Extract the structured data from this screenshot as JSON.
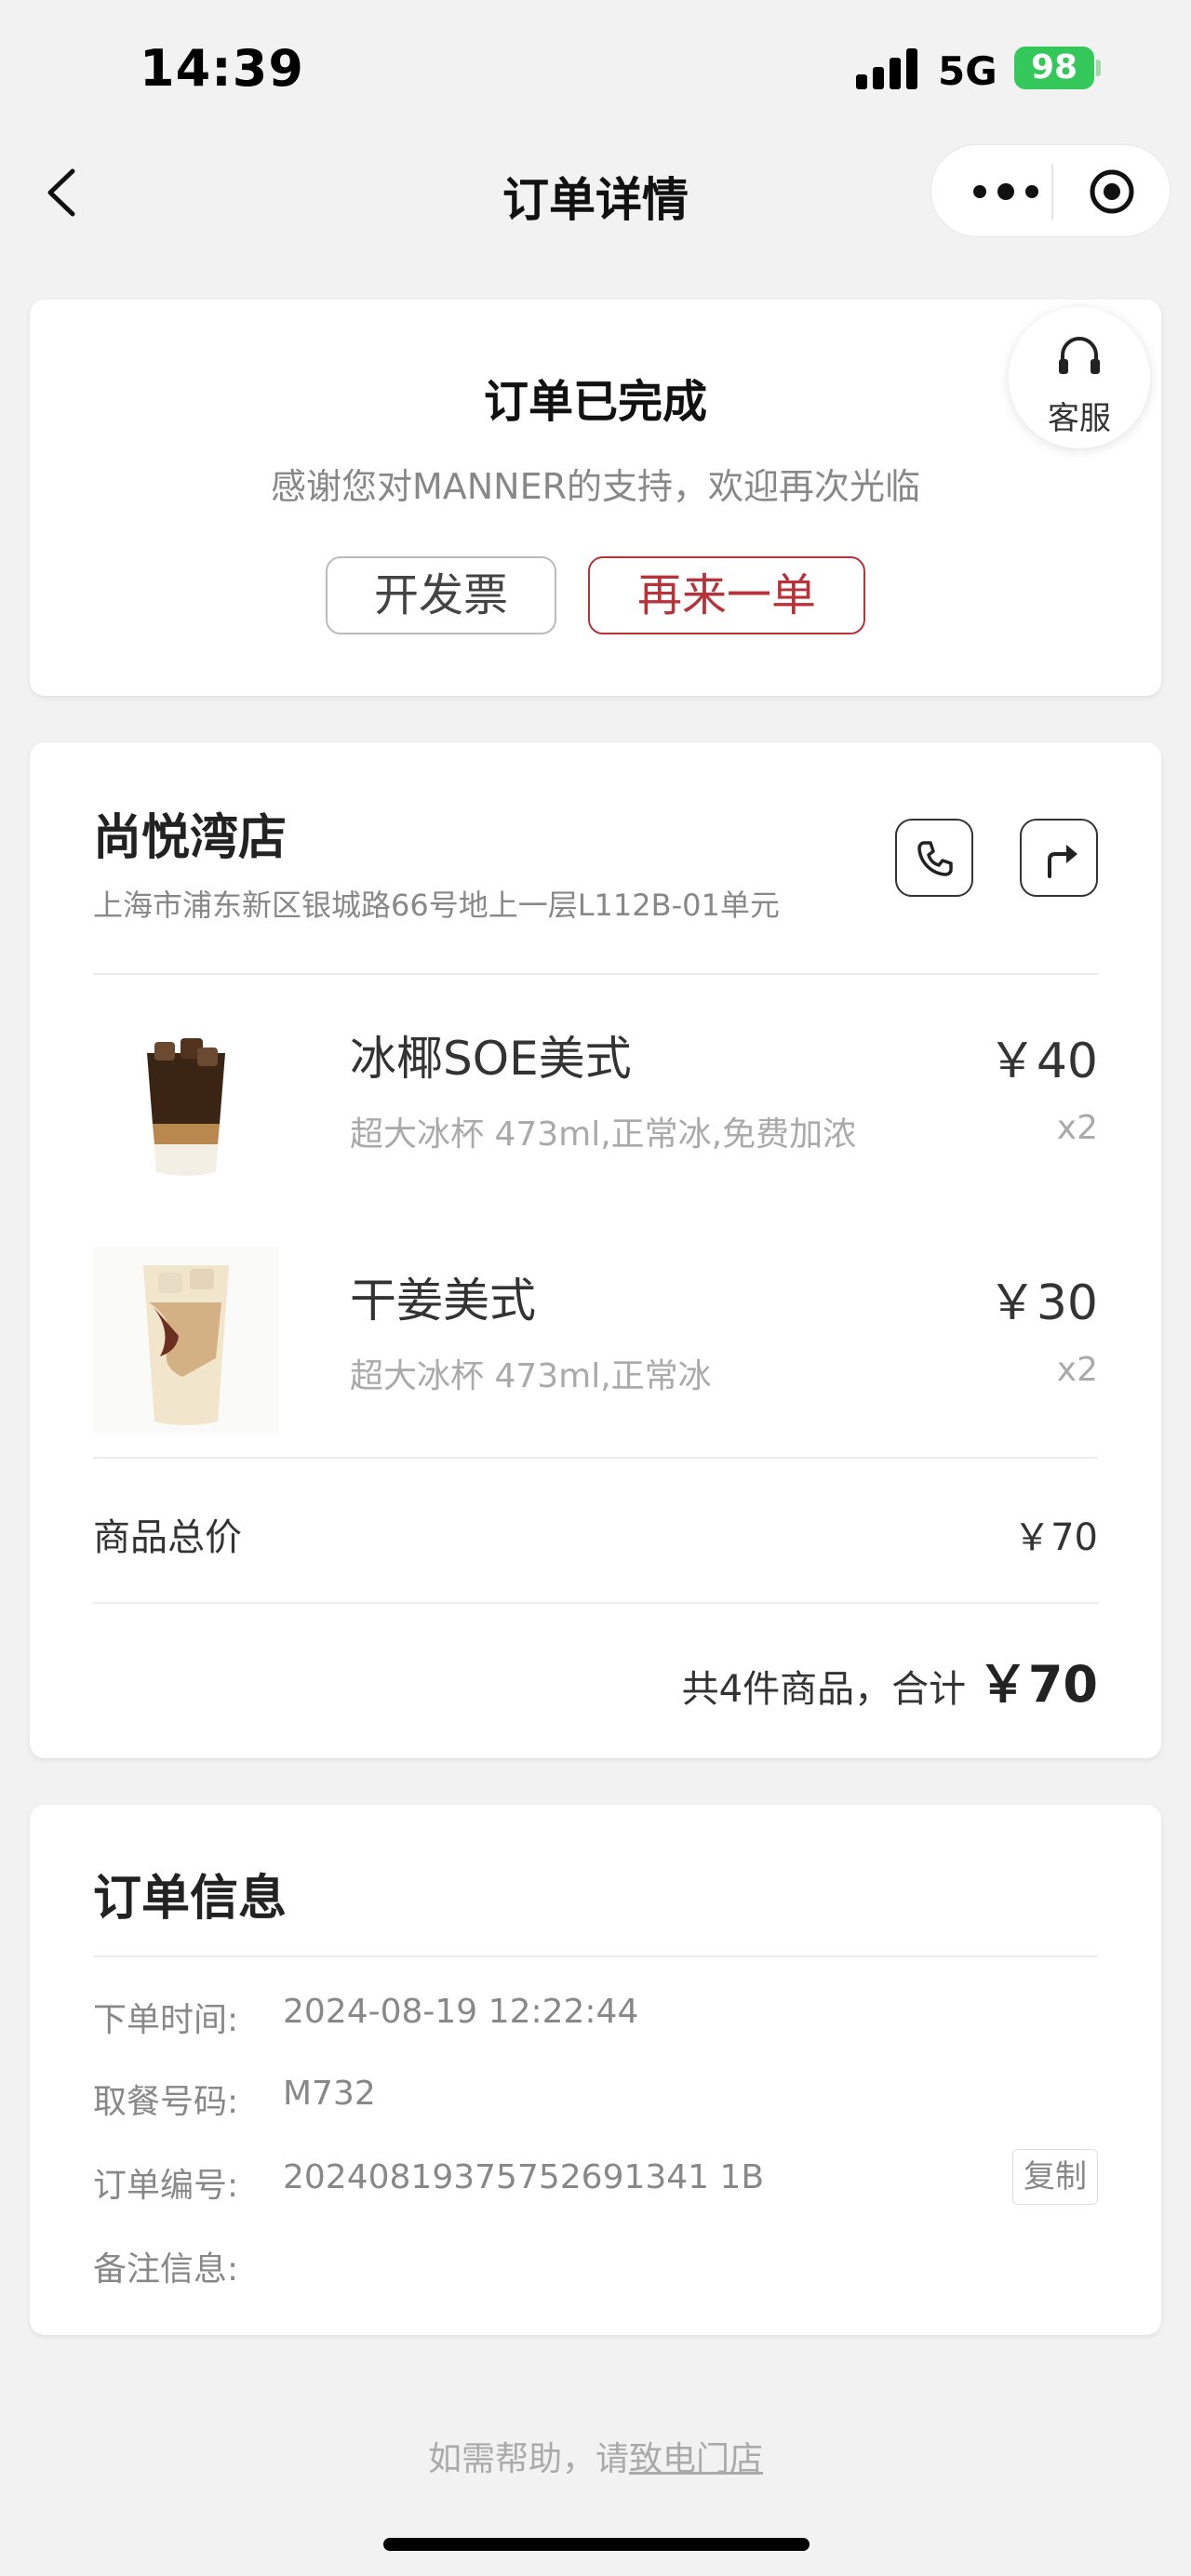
{
  "status_bar": {
    "time": "14:39",
    "network": "5G",
    "battery": "98"
  },
  "nav": {
    "title": "订单详情"
  },
  "status_card": {
    "title": "订单已完成",
    "subtitle": "感谢您对MANNER的支持，欢迎再次光临",
    "invoice_label": "开发票",
    "reorder_label": "再来一单",
    "service_label": "客服"
  },
  "store": {
    "name": "尚悦湾店",
    "address": "上海市浦东新区银城路66号地上一层L112B-01单元"
  },
  "items": [
    {
      "name": "冰椰SOE美式",
      "spec": "超大冰杯 473ml,正常冰,免费加浓",
      "price": "￥40",
      "qty": "x2"
    },
    {
      "name": "干姜美式",
      "spec": "超大冰杯 473ml,正常冰",
      "price": "￥30",
      "qty": "x2"
    }
  ],
  "summary": {
    "subtotal_label": "商品总价",
    "subtotal_value": "￥70",
    "total_prefix": "共4件商品，合计",
    "total_value": "￥70"
  },
  "order_info": {
    "title": "订单信息",
    "rows": [
      {
        "key": "下单时间:",
        "value": "2024-08-19 12:22:44"
      },
      {
        "key": "取餐号码:",
        "value": "M732"
      },
      {
        "key": "订单编号:",
        "value": "20240819375752691341 1B"
      },
      {
        "key": "备注信息:",
        "value": ""
      }
    ],
    "copy_label": "复制"
  },
  "footer": {
    "help_prefix": "如需帮助，请",
    "help_link": "致电门店"
  },
  "colors": {
    "accent": "#b8323a",
    "battery": "#34c759",
    "background": "#f2f2f2"
  }
}
